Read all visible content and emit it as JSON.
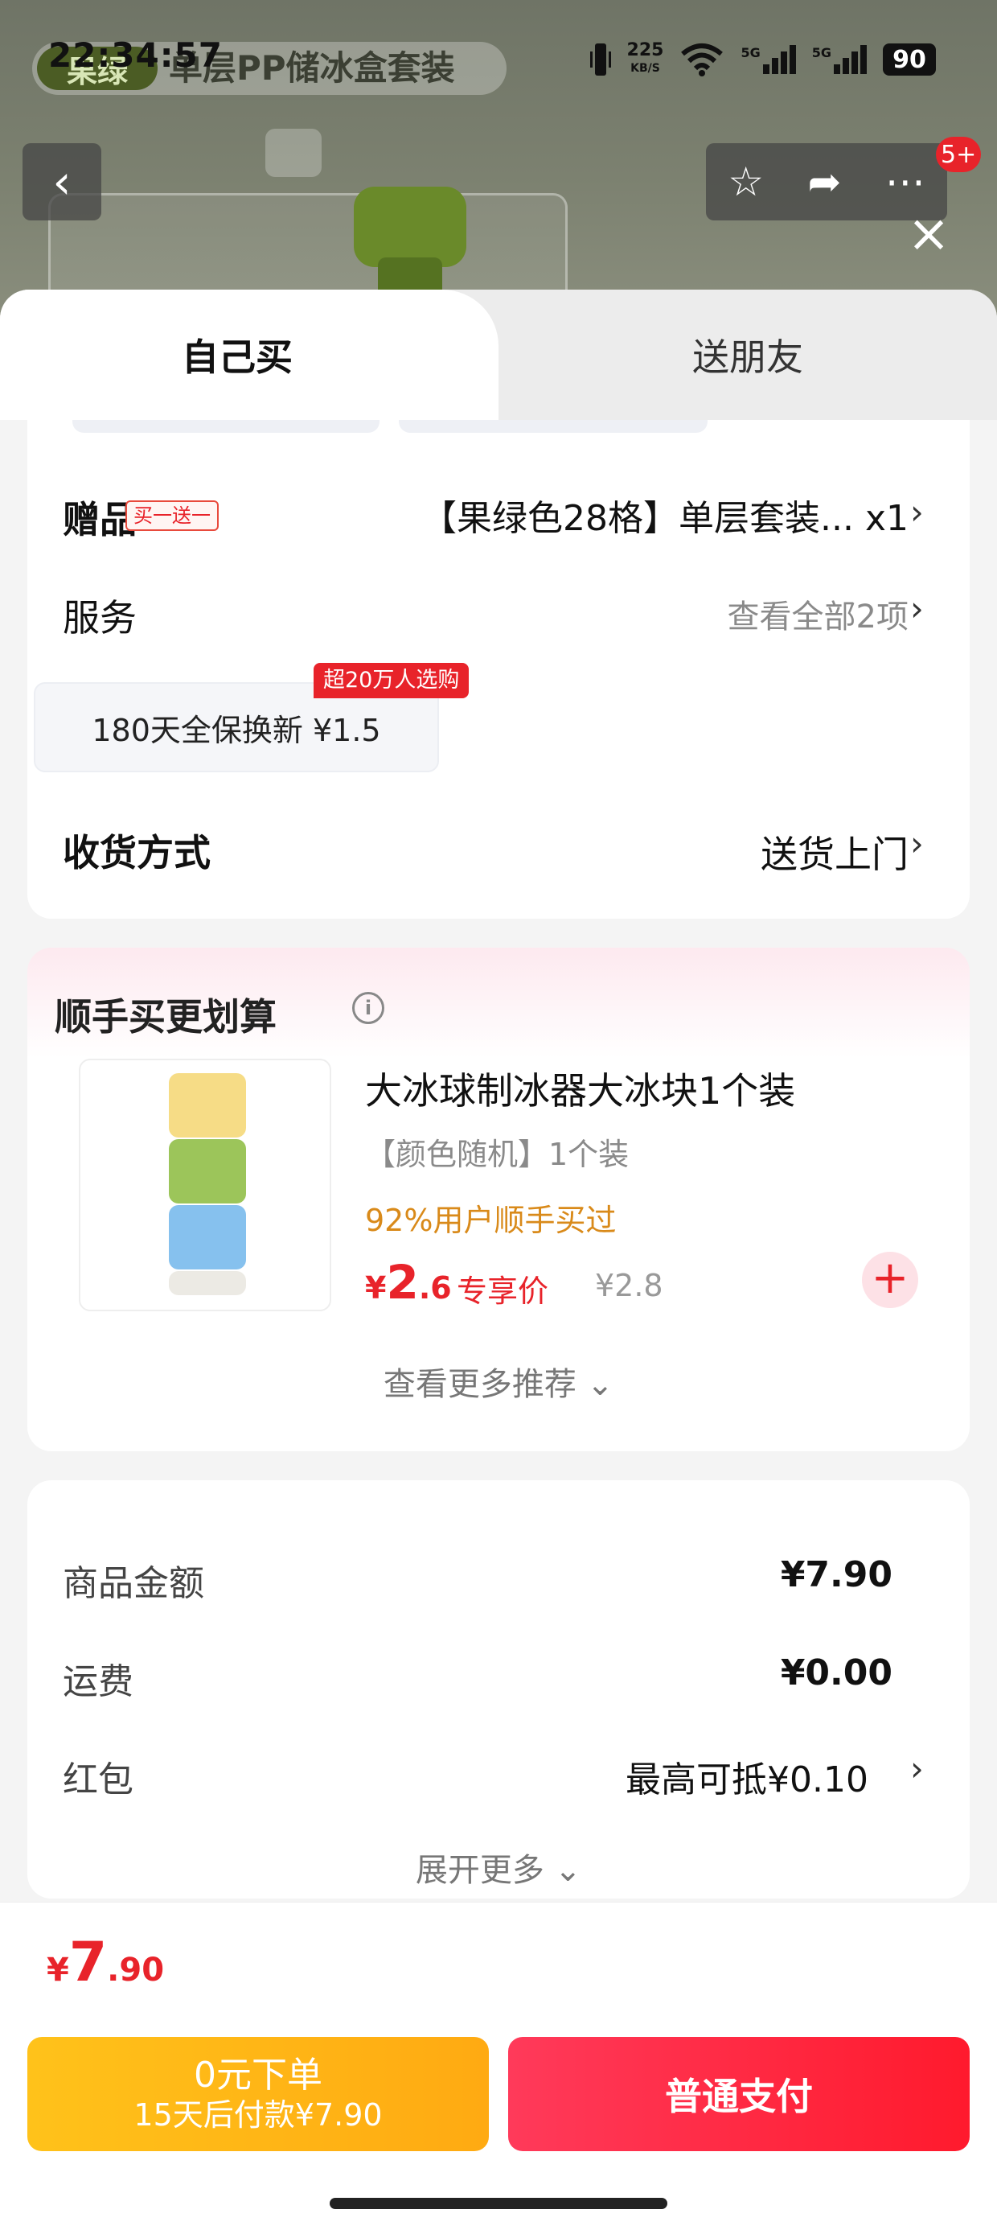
{
  "status_bar": {
    "time": "22:34:57",
    "net_speed": "225",
    "net_unit": "KB/S",
    "signal_1": "5G",
    "signal_2": "5G",
    "battery": "90"
  },
  "product_header": {
    "tag": "果绿",
    "title": "单层PP储冰盒套装"
  },
  "nav": {
    "badge": "5+",
    "back_icon": "chevron-left-icon",
    "action_icons": [
      "star-icon",
      "share-icon",
      "more-icon"
    ]
  },
  "tabs": {
    "self": "自己买",
    "friend": "送朋友"
  },
  "gift": {
    "label": "赠品",
    "tag": "买一送一",
    "value": "【果绿色28格】单层套装... x1"
  },
  "service": {
    "label": "服务",
    "more": "查看全部2项",
    "option": "180天全保换新  ¥1.5",
    "badge": "超20万人选购"
  },
  "delivery": {
    "label": "收货方式",
    "value": "送货上门"
  },
  "upsell": {
    "title": "顺手买更划算",
    "item": {
      "name": "大冰球制冰器大冰块1个装",
      "spec": "【颜色随机】1个装",
      "social": "92%用户顺手买过",
      "price_symbol": "¥",
      "price_int": "2",
      "price_dec": ".6",
      "price_label": "专享价",
      "orig_price": "¥2.8"
    },
    "see_more": "查看更多推荐 ⌄"
  },
  "summary": {
    "rows": [
      {
        "label": "商品金额",
        "value": "¥7.90"
      },
      {
        "label": "运费",
        "value": "¥0.00"
      },
      {
        "label": "红包",
        "value": "最高可抵¥0.10"
      }
    ],
    "expand": "展开更多 ⌄"
  },
  "checkout": {
    "total_symbol": "¥",
    "total_int": "7",
    "total_dec": ".90",
    "pay_later_title": "0元下单",
    "pay_later_sub": "15天后付款¥7.90",
    "pay_now": "普通支付"
  },
  "colors": {
    "accent_red": "#e8232a",
    "pay_later_yellow": "#ffb416",
    "social_orange": "#d98a1a"
  }
}
